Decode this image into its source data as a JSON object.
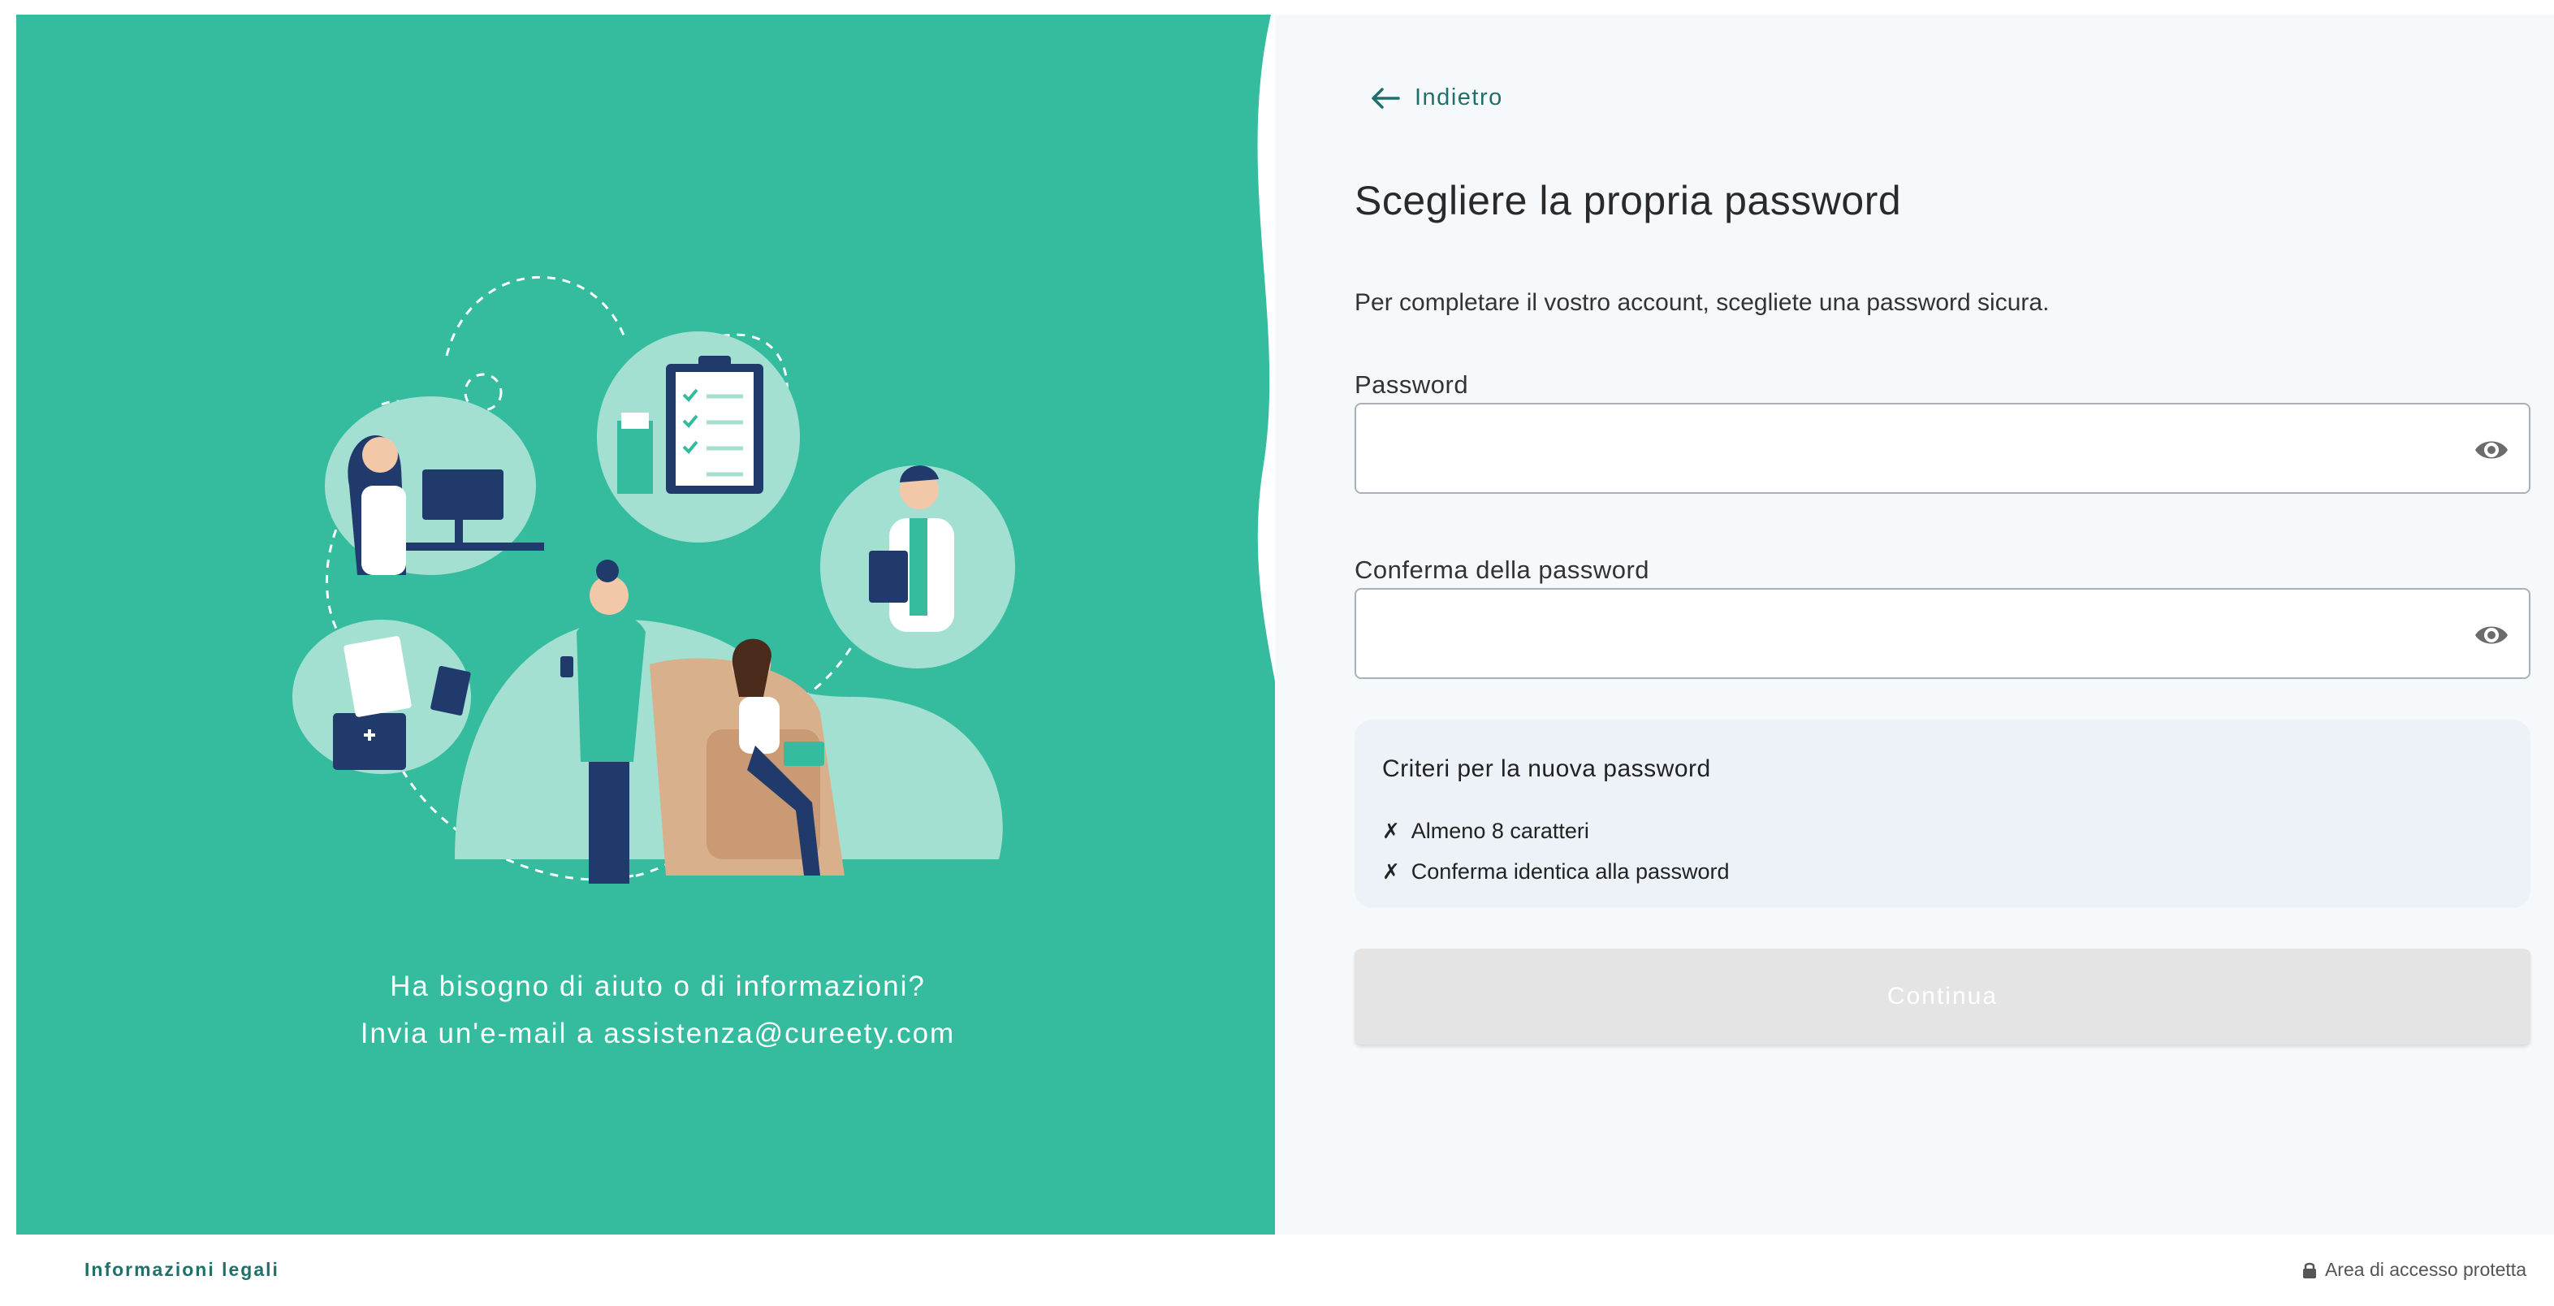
{
  "colors": {
    "brand_teal": "#35bc9f",
    "light_teal": "#a3e0d2",
    "dark_navy": "#1f3a6b",
    "link_teal": "#1f6f6a",
    "right_bg": "#f6f9fc"
  },
  "left": {
    "help_line1": "Ha bisogno di aiuto o di informazioni?",
    "help_line2": "Invia un'e-mail a assistenza@cureety.com",
    "illustration": "medical-team-illustration"
  },
  "form": {
    "back_label": "Indietro",
    "back_icon": "arrow-left-icon",
    "title": "Scegliere la propria password",
    "subtitle": "Per completare il vostro account, scegliete una password sicura.",
    "password_label": "Password",
    "password_value": "",
    "confirm_label": "Conferma della password",
    "confirm_value": "",
    "eye_icon": "eye-icon",
    "criteria": {
      "title": "Criteri per la nuova password",
      "mark": "✗",
      "items": [
        "Almeno 8 caratteri",
        "Conferma identica alla password"
      ]
    },
    "continue_label": "Continua"
  },
  "footer": {
    "legal_label": "Informazioni legali",
    "secure_label": "Area di accesso protetta",
    "secure_icon": "lock-icon"
  }
}
